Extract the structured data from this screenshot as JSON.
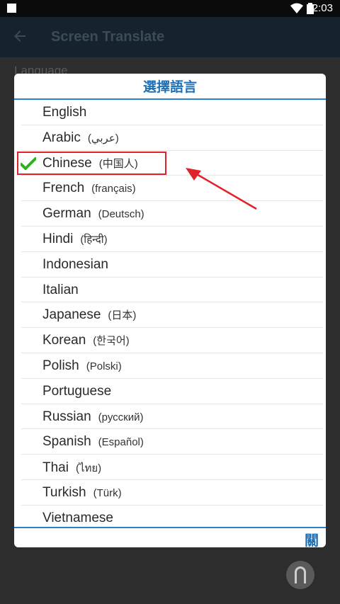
{
  "status_bar": {
    "time": "12:03"
  },
  "app_bar": {
    "title": "Screen Translate"
  },
  "background": {
    "section_label": "Language"
  },
  "dialog": {
    "title": "選擇語言",
    "close_label": "關",
    "selected": "Chinese",
    "languages": [
      {
        "name": "English",
        "native": ""
      },
      {
        "name": "Arabic",
        "native": "(عربي)"
      },
      {
        "name": "Chinese",
        "native": "(中国人)"
      },
      {
        "name": "French",
        "native": "(français)"
      },
      {
        "name": "German",
        "native": "(Deutsch)"
      },
      {
        "name": "Hindi",
        "native": "(हिन्दी)"
      },
      {
        "name": "Indonesian",
        "native": ""
      },
      {
        "name": "Italian",
        "native": ""
      },
      {
        "name": "Japanese",
        "native": "(日本)"
      },
      {
        "name": "Korean",
        "native": "(한국어)"
      },
      {
        "name": "Polish",
        "native": "(Polski)"
      },
      {
        "name": "Portuguese",
        "native": ""
      },
      {
        "name": "Russian",
        "native": "(русский)"
      },
      {
        "name": "Spanish",
        "native": "(Español)"
      },
      {
        "name": "Thai",
        "native": "(ไทย)"
      },
      {
        "name": "Turkish",
        "native": "(Türk)"
      },
      {
        "name": "Vietnamese",
        "native": ""
      }
    ]
  },
  "colors": {
    "accent": "#1f6fb4",
    "highlight": "#e0232b",
    "check": "#2bb31a"
  },
  "icons": [
    "notification-square-icon",
    "wifi-icon",
    "battery-icon",
    "back-arrow-icon",
    "checkmark-icon",
    "annotation-arrow-icon",
    "floating-assistant-icon"
  ]
}
